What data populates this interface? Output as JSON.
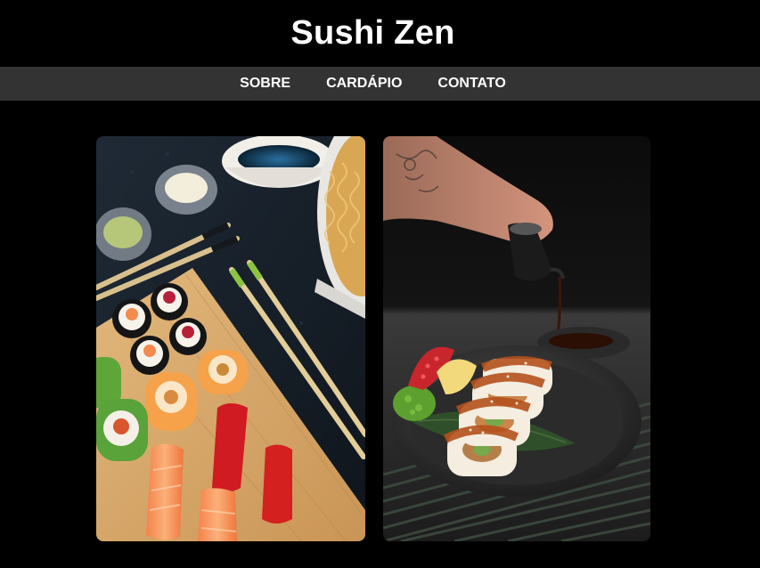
{
  "header": {
    "title": "Sushi Zen"
  },
  "nav": {
    "items": [
      {
        "label": "SOBRE"
      },
      {
        "label": "CARDÁPIO"
      },
      {
        "label": "CONTATO"
      }
    ]
  },
  "gallery": {
    "photos": [
      {
        "icon": "sushi-platter-photo"
      },
      {
        "icon": "sushi-rolls-plate-photo"
      }
    ]
  },
  "colors": {
    "background": "#000000",
    "nav_bar": "#333333",
    "text": "#ffffff"
  }
}
